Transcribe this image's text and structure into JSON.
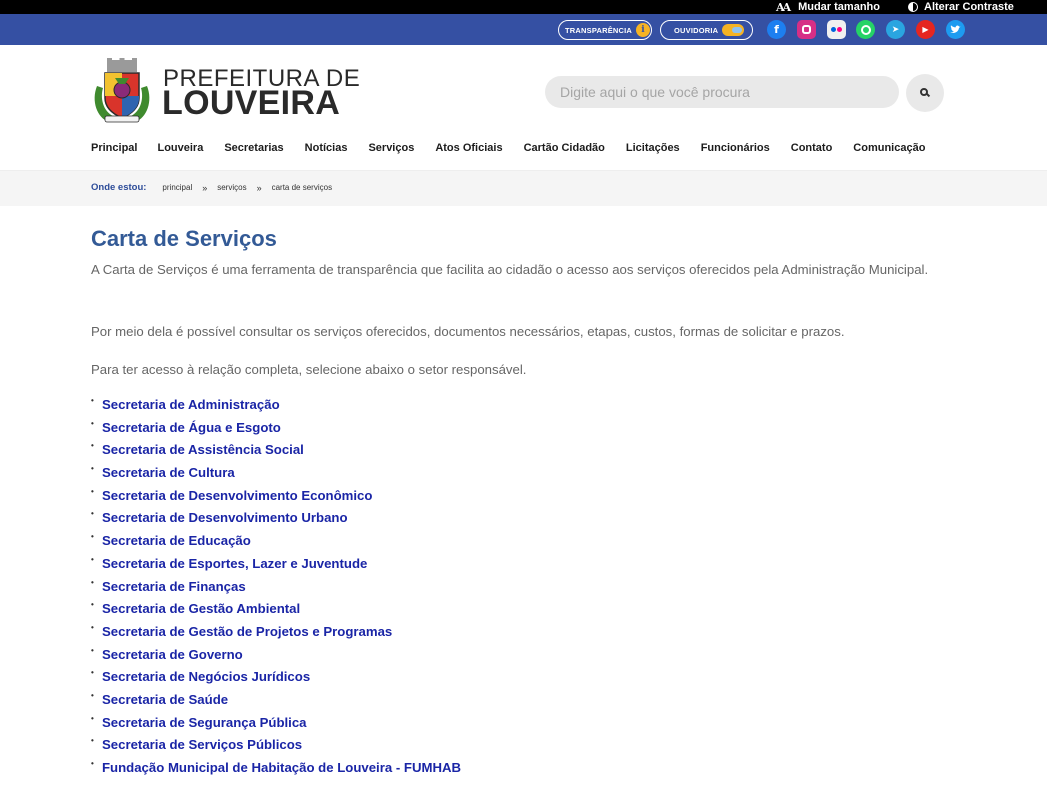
{
  "accessibility": {
    "size_label": "Mudar tamanho",
    "size_glyph": "AA",
    "contrast_label": "Alterar Contraste"
  },
  "topbar": {
    "transparency_label": "TRANSPARÊNCIA",
    "ombudsman_label": "OUVIDORIA",
    "info_glyph": "i",
    "social": [
      {
        "name": "facebook",
        "glyph": "f"
      },
      {
        "name": "instagram",
        "glyph": ""
      },
      {
        "name": "flickr",
        "glyph": ""
      },
      {
        "name": "whatsapp",
        "glyph": ""
      },
      {
        "name": "telegram",
        "glyph": "➤"
      },
      {
        "name": "youtube",
        "glyph": "▶"
      },
      {
        "name": "twitter",
        "glyph": "🐦"
      }
    ]
  },
  "logo": {
    "line1": "PREFEITURA DE",
    "line2": "LOUVEIRA"
  },
  "search": {
    "placeholder": "Digite aqui o que você procura"
  },
  "nav": [
    "Principal",
    "Louveira",
    "Secretarias",
    "Notícias",
    "Serviços",
    "Atos Oficiais",
    "Cartão Cidadão",
    "Licitações",
    "Funcionários",
    "Contato",
    "Comunicação"
  ],
  "breadcrumb": {
    "label": "Onde estou:",
    "items": [
      "principal",
      "serviços",
      "carta de serviços"
    ],
    "separator": "»"
  },
  "main": {
    "title": "Carta de Serviços",
    "paragraphs": [
      "A Carta de Serviços é uma ferramenta de transparência que facilita ao cidadão o acesso aos serviços oferecidos pela Administração Municipal.",
      "Por meio dela é possível consultar os serviços oferecidos, documentos necessários, etapas, custos, formas de solicitar e prazos.",
      "Para ter acesso à relação completa, selecione abaixo o setor responsável."
    ],
    "bullet": "•",
    "secretariats": [
      "Secretaria de Administração",
      "Secretaria de Água e Esgoto",
      "Secretaria de Assistência Social",
      "Secretaria de Cultura",
      "Secretaria de Desenvolvimento Econômico",
      "Secretaria de Desenvolvimento Urbano",
      "Secretaria de Educação",
      "Secretaria de Esportes, Lazer e Juventude",
      "Secretaria de Finanças",
      "Secretaria de Gestão Ambiental",
      "Secretaria de Gestão de Projetos e Programas",
      "Secretaria de Governo",
      "Secretaria de Negócios Jurídicos",
      "Secretaria de Saúde",
      "Secretaria de Segurança Pública",
      "Secretaria de Serviços Públicos",
      "Fundação Municipal de Habitação de Louveira - FUMHAB"
    ]
  },
  "colors": {
    "topbar": "#3550a3",
    "title": "#335a96",
    "link": "#1a25a6",
    "accent_yellow": "#f5b324"
  }
}
